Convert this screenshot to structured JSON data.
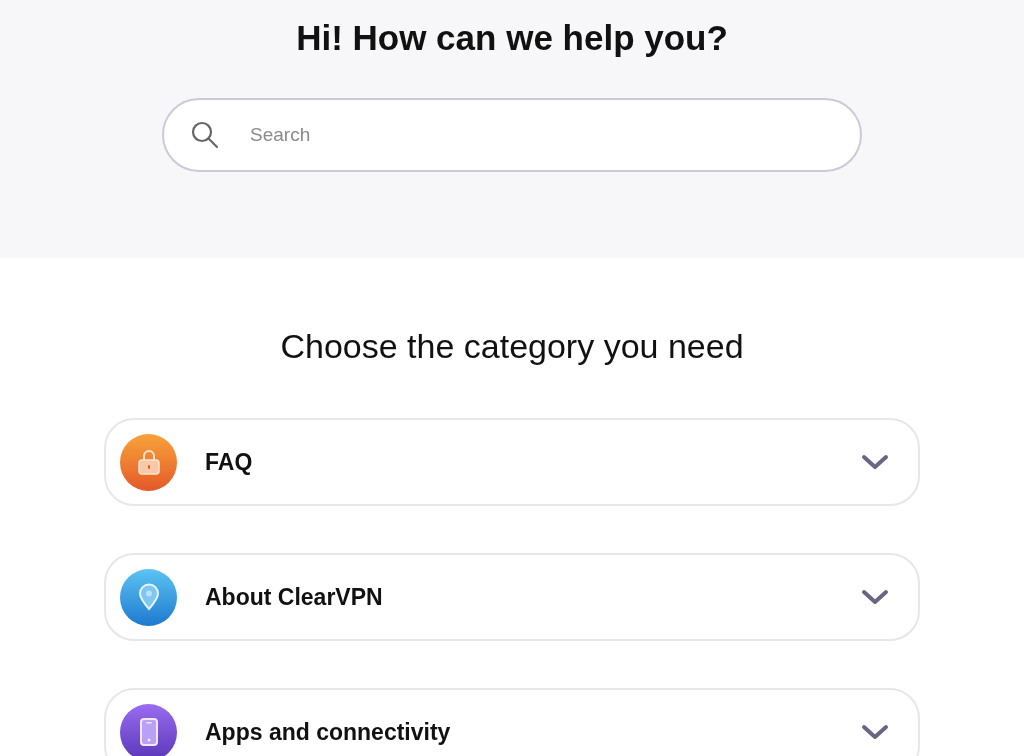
{
  "header": {
    "title": "Hi! How can we help you?",
    "search": {
      "placeholder": "Search"
    }
  },
  "categories_section": {
    "heading": "Choose the category you need",
    "categories": [
      {
        "kind": "lock",
        "label": "FAQ",
        "expanded": false
      },
      {
        "kind": "pin",
        "label": "About ClearVPN",
        "expanded": false
      },
      {
        "kind": "phone",
        "label": "Apps and connectivity",
        "expanded": false
      }
    ]
  }
}
